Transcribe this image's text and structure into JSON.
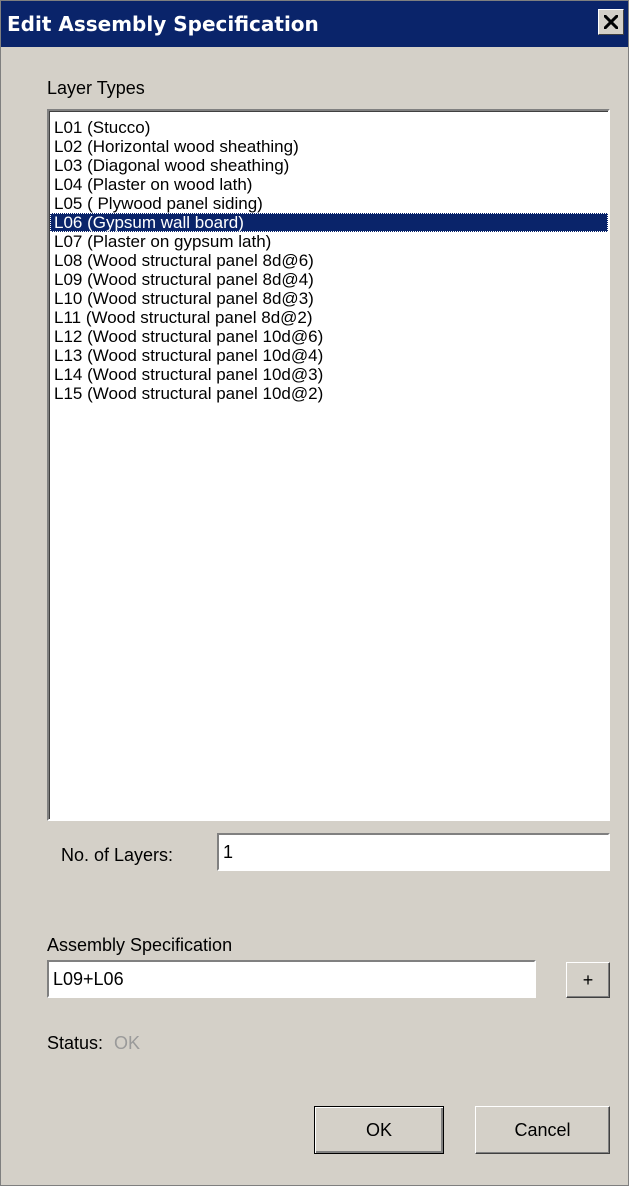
{
  "window": {
    "title": "Edit Assembly Specification",
    "close_symbol": "close-icon"
  },
  "layer_types": {
    "label": "Layer Types",
    "selected": "L06 (Gypsum wall board)",
    "items": [
      "L01 (Stucco)",
      "L02 (Horizontal wood sheathing)",
      "L03 (Diagonal wood sheathing)",
      "L04 (Plaster on wood lath)",
      "L05 ( Plywood panel siding)",
      "L06 (Gypsum wall board)",
      "L07 (Plaster on gypsum lath)",
      "L08 (Wood structural panel 8d@6)",
      "L09 (Wood structural panel 8d@4)",
      "L10 (Wood structural panel 8d@3)",
      "L11 (Wood structural panel 8d@2)",
      "L12 (Wood structural panel 10d@6)",
      "L13 (Wood structural panel 10d@4)",
      "L14 (Wood structural panel 10d@3)",
      "L15 (Wood structural panel 10d@2)"
    ]
  },
  "layers": {
    "label": "No. of Layers:",
    "value": "1"
  },
  "assembly": {
    "label": "Assembly Specification",
    "value": "L09+L06",
    "add_label": "+"
  },
  "status": {
    "label": "Status:",
    "value": "OK"
  },
  "buttons": {
    "ok": "OK",
    "cancel": "Cancel"
  },
  "colors": {
    "titlebar": "#0a246a",
    "dialog_bg": "#d4d0c8",
    "selection": "#0a246a",
    "status_text": "#9a9a9a"
  }
}
